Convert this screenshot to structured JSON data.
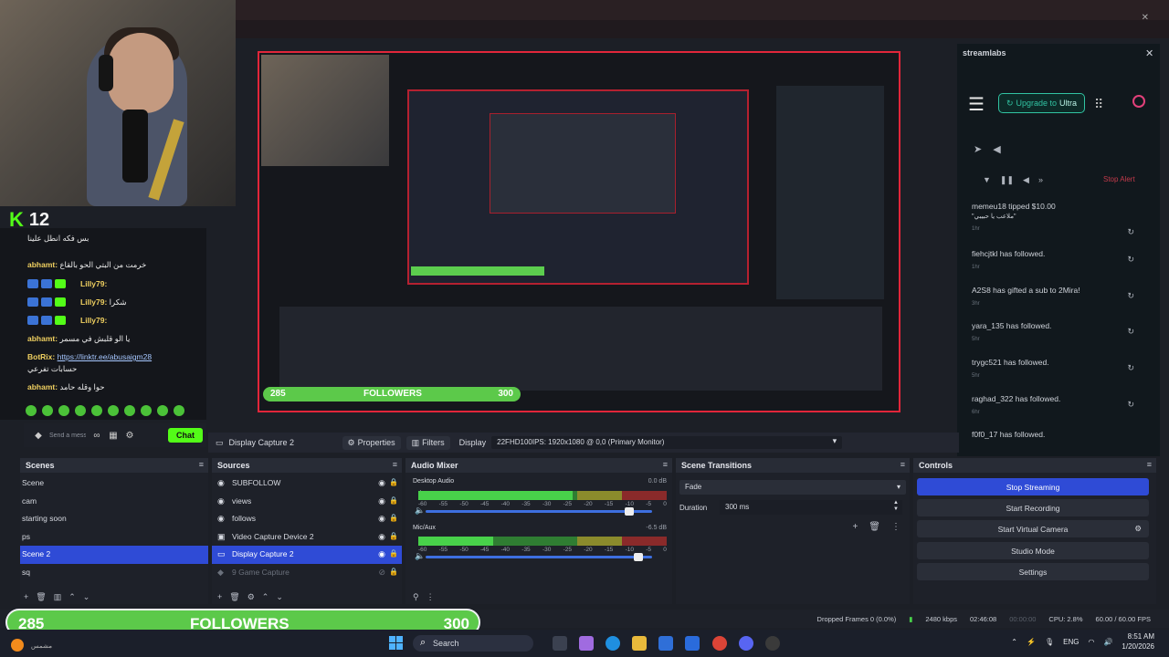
{
  "webcam_overlay": {
    "kick_count": "12"
  },
  "chat": {
    "messages": [
      {
        "user": "",
        "text": "بس فكه انطل علينا"
      },
      {
        "user": "abhamt:",
        "text": "خرمت من البتي الحو بالقاع"
      },
      {
        "user": "Lilly79:",
        "text": ""
      },
      {
        "user": "Lilly79:",
        "text": "شكرا"
      },
      {
        "user": "Lilly79:",
        "text": ""
      },
      {
        "user": "abhamt:",
        "text": "يا الو قلبش في مسمر"
      },
      {
        "user": "BotRix:",
        "link": "https://linktr.ee/abusaigm28",
        "text": "حسابات تفرعي"
      },
      {
        "user": "abhamt:",
        "text": "حوا وقله حامد"
      }
    ],
    "send_placeholder": "Send a message",
    "chat_button": "Chat"
  },
  "preview": {
    "followers_label": "FOLLOWERS",
    "followers_current": "285",
    "followers_goal": "300"
  },
  "streamlabs": {
    "title": "streamlabs",
    "upgrade_prefix": "Upgrade to",
    "upgrade_plan": "Ultra",
    "stop_alert": "Stop Alert",
    "alerts": [
      {
        "text": "memeu18 tipped $10.00",
        "sub": "\"ملاعب يا حبيبي\"",
        "time": "1hr"
      },
      {
        "text": "fiehcjtkl has followed.",
        "time": "1hr"
      },
      {
        "text": "A2S8 has gifted a sub to 2Mira!",
        "time": "3hr"
      },
      {
        "text": "yara_135 has followed.",
        "time": "5hr"
      },
      {
        "text": "trygc521 has followed.",
        "time": "5hr"
      },
      {
        "text": "raghad_322 has followed.",
        "time": "6hr"
      },
      {
        "text": "f0f0_17 has followed.",
        "time": ""
      }
    ]
  },
  "source_toolbar": {
    "selected_source": "Display Capture 2",
    "properties": "Properties",
    "filters": "Filters",
    "display_label": "Display",
    "display_value": "22FHD100IPS: 1920x1080 @ 0,0 (Primary Monitor)"
  },
  "scenes": {
    "title": "Scenes",
    "items": [
      "Scene",
      "cam",
      "starting soon",
      "ps",
      "Scene 2",
      "sq"
    ],
    "selected_index": 4
  },
  "sources": {
    "title": "Sources",
    "items": [
      "SUBFOLLOW",
      "views",
      "follows",
      "Video Capture Device 2",
      "Display Capture 2",
      "9 Game Capture"
    ],
    "selected_index": 4
  },
  "audio_mixer": {
    "title": "Audio Mixer",
    "channels": [
      {
        "name": "Desktop Audio",
        "db": "0.0 dB",
        "level": 0.62,
        "volume": 0.9
      },
      {
        "name": "Mic/Aux",
        "db": "-6.5 dB",
        "level": 0.3,
        "volume": 0.94
      }
    ],
    "scale": [
      "-60",
      "-55",
      "-50",
      "-45",
      "-40",
      "-35",
      "-30",
      "-25",
      "-20",
      "-15",
      "-10",
      "-5",
      "0"
    ]
  },
  "scene_transitions": {
    "title": "Scene Transitions",
    "transition": "Fade",
    "duration_label": "Duration",
    "duration_value": "300 ms"
  },
  "controls": {
    "title": "Controls",
    "buttons": [
      "Stop Streaming",
      "Start Recording",
      "Start Virtual Camera",
      "Studio Mode",
      "Settings"
    ]
  },
  "status": {
    "dropped_frames": "Dropped Frames 0 (0.0%)",
    "bitrate": "2480 kbps",
    "live_time": "02:46:08",
    "rec_time": "00:00:00",
    "cpu": "CPU: 2.8%",
    "fps": "60.00 / 60.00 FPS"
  },
  "follower_bar": {
    "current": "285",
    "label": "FOLLOWERS",
    "goal": "300"
  },
  "taskbar": {
    "search": "Search",
    "language": "ENG",
    "time": "8:51 AM",
    "date": "1/20/2026",
    "weather_text": "مشمس"
  },
  "colors": {
    "accent": "#2f4bd6",
    "kick_green": "#53fc18",
    "alert_red": "#e1263a",
    "streamlabs_teal": "#31c3a2"
  }
}
